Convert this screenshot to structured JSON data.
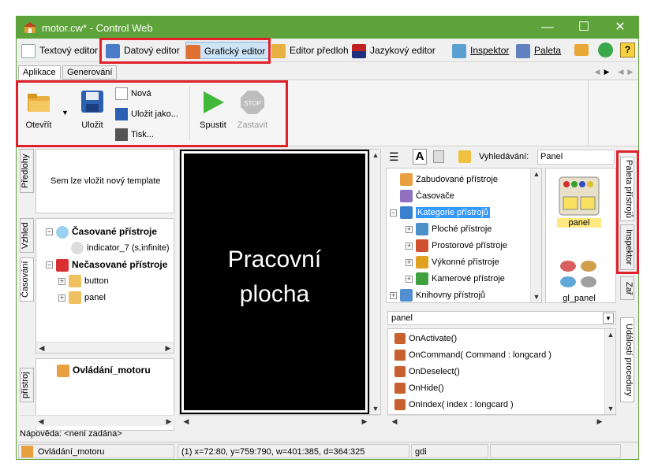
{
  "window": {
    "title": "motor.cw* - Control Web"
  },
  "toolbar": {
    "text_editor": "Textový editor",
    "data_editor": "Datový editor",
    "graphic_editor": "Grafický editor",
    "template_editor": "Editor předloh",
    "language_editor": "Jazykový editor",
    "inspector": "Inspektor",
    "palette": "Paleta"
  },
  "ribbon_tabs": [
    "Aplikace",
    "Generování"
  ],
  "ribbon": {
    "open": "Otevřít",
    "save": "Uložit",
    "new": "Nová",
    "save_as": "Uložit jako...",
    "print": "Tisk...",
    "run": "Spustit",
    "stop": "Zastavit",
    "stop_icon_text": "STOP"
  },
  "left_tabs": {
    "templates": "Předlohy",
    "view": "Vzhled",
    "timing": "Časování",
    "instruments": "přístroj"
  },
  "templates_panel": {
    "message": "Sem lze vložit nový template"
  },
  "timing_tree": {
    "timed": "Časované přístroje",
    "indicator": "indicator_7 (s,infinite)",
    "untimed": "Nečasované přístroje",
    "button": "button",
    "panel": "panel"
  },
  "instrument_panel": {
    "title": "Ovládání_motoru"
  },
  "workspace": {
    "line1": "Pracovní",
    "line2": "plocha"
  },
  "palette_toolbar": {
    "search_label": "Vyhledávání:",
    "search_value": "Panel"
  },
  "palette_tree": [
    {
      "label": "Zabudované přístroje",
      "indent": 0,
      "expander": ""
    },
    {
      "label": "Časovače",
      "indent": 0,
      "expander": ""
    },
    {
      "label": "Kategorie přístrojů",
      "indent": 0,
      "expander": "−",
      "selected": true
    },
    {
      "label": "Ploché přístroje",
      "indent": 1,
      "expander": "+"
    },
    {
      "label": "Prostorové přístroje",
      "indent": 1,
      "expander": "+"
    },
    {
      "label": "Výkonné přístroje",
      "indent": 1,
      "expander": "+"
    },
    {
      "label": "Kamerové přístroje",
      "indent": 1,
      "expander": "+"
    },
    {
      "label": "Knihovny přístrojů",
      "indent": 0,
      "expander": "+"
    }
  ],
  "palette_items": {
    "panel": "panel",
    "gl_panel": "gl_panel"
  },
  "right_tabs": {
    "palette": "Paleta přístrojů",
    "inspector": "Inspektor",
    "zar": "Zař",
    "events": "Událostí procedury"
  },
  "events_panel": {
    "selected": "panel",
    "items": [
      "OnActivate()",
      "OnCommand( Command : longcard )",
      "OnDeselect()",
      "OnHide()",
      "OnIndex( index : longcard )"
    ]
  },
  "hint": {
    "label": "Nápověda:",
    "value": "<není zadána>"
  },
  "status": {
    "instrument": "Ovládání_motoru",
    "coords": "(1) x=72:80, y=759:790, w=401:385, d=364:325",
    "renderer": "gdi"
  },
  "colors": {
    "title_green": "#5ea33a",
    "highlight": "#e0202a",
    "selection": "#3399ff"
  }
}
